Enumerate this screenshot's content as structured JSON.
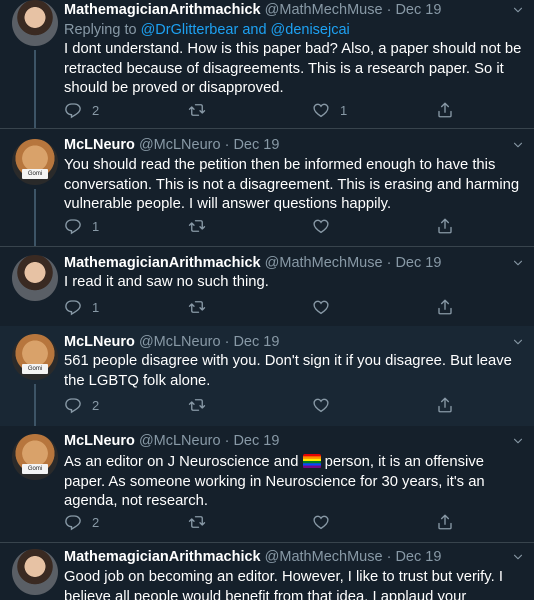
{
  "tweets": [
    {
      "name": "MathemagicianArithmachick",
      "handle": "@MathMechMuse",
      "sep": "·",
      "date": "Dec 19",
      "replying_prefix": "Replying to ",
      "replying_link": "@DrGlitterbear and @denisejcai",
      "text": "I dont understand. How is this paper bad?  Also, a paper should not be retracted because of disagreements. This is a research paper. So it should be proved or disapproved.",
      "replies": "2",
      "retweets": "",
      "likes": "1"
    },
    {
      "name": "McLNeuro",
      "handle": "@McLNeuro",
      "sep": "·",
      "date": "Dec 19",
      "text": "You should read the petition then be informed enough to have this conversation. This is not a disagreement. This is erasing and harming vulnerable people. I will answer questions happily.",
      "replies": "1",
      "retweets": "",
      "likes": ""
    },
    {
      "name": "MathemagicianArithmachick",
      "handle": "@MathMechMuse",
      "sep": "·",
      "date": "Dec 19",
      "text": "I read it and saw no such thing.",
      "replies": "1",
      "retweets": "",
      "likes": ""
    },
    {
      "name": "McLNeuro",
      "handle": "@McLNeuro",
      "sep": "·",
      "date": "Dec 19",
      "text": "561 people disagree with you. Don't sign it if you disagree. But leave the LGBTQ folk alone.",
      "replies": "2",
      "retweets": "",
      "likes": ""
    },
    {
      "name": "McLNeuro",
      "handle": "@McLNeuro",
      "sep": "·",
      "date": "Dec 19",
      "text_before": "As an editor on J Neuroscience and ",
      "text_after": " person, it is an offensive paper. As someone working in Neuroscience for 30 years, it's an agenda, not research.",
      "replies": "2",
      "retweets": "",
      "likes": ""
    },
    {
      "name": "MathemagicianArithmachick",
      "handle": "@MathMechMuse",
      "sep": "·",
      "date": "Dec 19",
      "text": "Good job on becoming an editor. However, I like to trust but verify. I believe all people would benefit from that idea. I applaud your"
    }
  ],
  "avatar_sign": "Gomi",
  "icons": {
    "reply": "reply-icon",
    "retweet": "retweet-icon",
    "like": "heart-icon",
    "share": "share-icon",
    "more": "chevron-down-icon"
  },
  "colors": {
    "background": "#15202b",
    "highlight": "#192734",
    "link": "#1da1f2",
    "muted": "#8899a6",
    "divider": "#38444d"
  }
}
